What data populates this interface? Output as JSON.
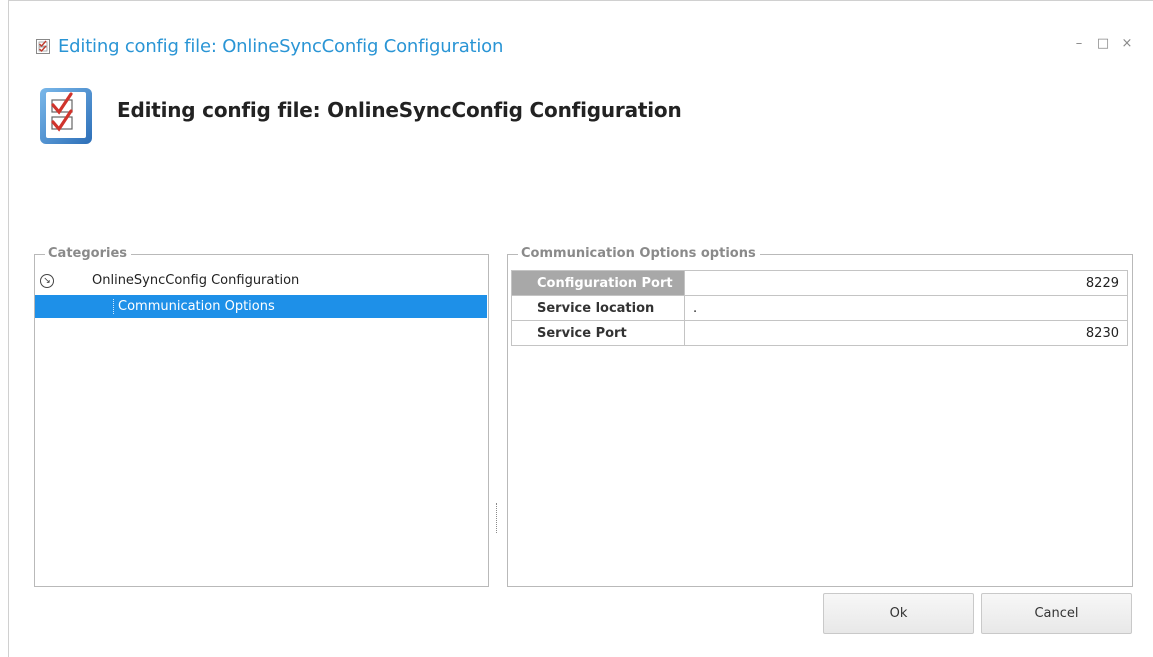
{
  "window": {
    "title": "Editing config file: OnlineSyncConfig Configuration",
    "controls": {
      "minimize": "–",
      "maximize": "□",
      "close": "×"
    }
  },
  "header": {
    "title": "Editing config file: OnlineSyncConfig Configuration",
    "icon": "checklist-icon"
  },
  "categories": {
    "legend": "Categories",
    "root": {
      "label": "OnlineSyncConfig Configuration",
      "expander_icon": "collapse-arrow-icon"
    },
    "children": [
      {
        "label": "Communication Options",
        "selected": true
      }
    ]
  },
  "options": {
    "legend": "Communication Options options",
    "rows": [
      {
        "key": "Configuration Port",
        "value": "8229",
        "selected": true
      },
      {
        "key": "Service location",
        "value": ".",
        "selected": false
      },
      {
        "key": "Service Port",
        "value": "8230",
        "selected": false
      }
    ]
  },
  "buttons": {
    "ok": "Ok",
    "cancel": "Cancel"
  },
  "colors": {
    "accent": "#2a95d5",
    "selection": "#1e90e8",
    "selected_key": "#a8a8a8"
  }
}
